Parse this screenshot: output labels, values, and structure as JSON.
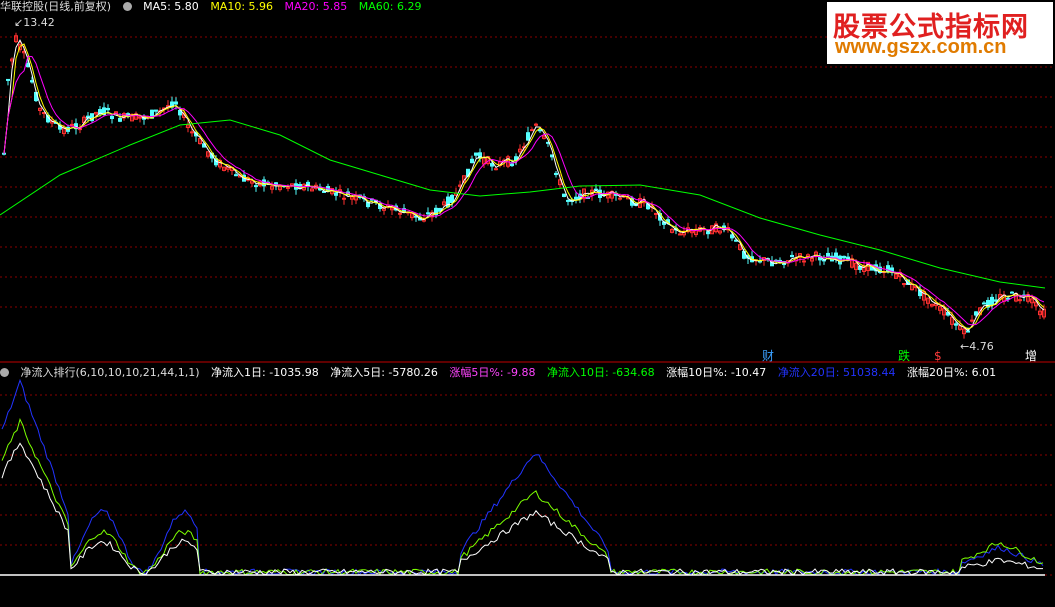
{
  "price_panel": {
    "title": "华联控股(日线,前复权)",
    "legend": [
      {
        "label": "MA5: 5.80",
        "color": "#ffffff"
      },
      {
        "label": "MA10: 5.96",
        "color": "#ffff00"
      },
      {
        "label": "MA20: 5.85",
        "color": "#ff00ff"
      },
      {
        "label": "MA60: 6.29",
        "color": "#00ff00"
      }
    ],
    "high_label": "13.42",
    "low_label": "4.76",
    "event_markers": [
      {
        "text": "财",
        "color": "#3aa0ff"
      },
      {
        "text": "跌",
        "color": "#00ff00"
      },
      {
        "text": "$",
        "color": "#ff3b3b"
      },
      {
        "text": "增",
        "color": "#ffffff"
      }
    ]
  },
  "indicator_panel": {
    "name": "净流入排行(6,10,10,10,21,44,1,1)",
    "values": [
      {
        "label": "净流入1日: -1035.98",
        "color": "#ffffff"
      },
      {
        "label": "净流入5日: -5780.26",
        "color": "#ffffff"
      },
      {
        "label": "涨幅5日%: -9.88",
        "color": "#ff44ff"
      },
      {
        "label": "净流入10日: -634.68",
        "color": "#00ff00"
      },
      {
        "label": "涨幅10日%: -10.47",
        "color": "#ffffff"
      },
      {
        "label": "净流入20日: 51038.44",
        "color": "#2233ff"
      },
      {
        "label": "涨幅20日%: 6.01",
        "color": "#ffffff"
      }
    ]
  },
  "watermark": {
    "title": "股票公式指标网",
    "url": "www.gszx.com.cn"
  },
  "colors": {
    "background": "#000000",
    "grid": "#8a0000",
    "up": "#ff3030",
    "down": "#54ffff",
    "ma5": "#ffffff",
    "ma10": "#ffff00",
    "ma20": "#ff00ff",
    "ma60": "#00ff00",
    "ind_blue": "#2233ff",
    "ind_green": "#7cff00",
    "ind_white": "#ffffff"
  }
}
